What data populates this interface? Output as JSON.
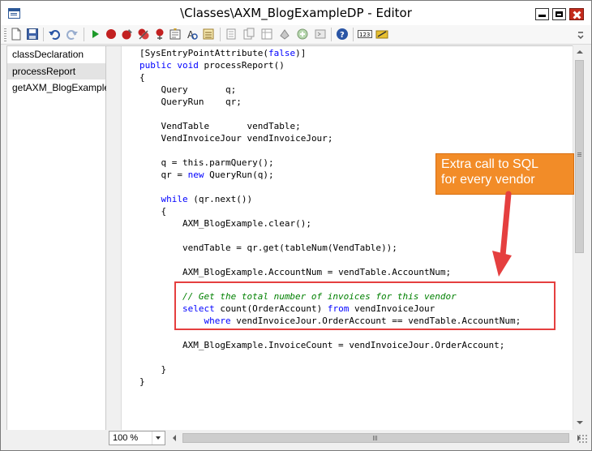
{
  "window": {
    "title": "\\Classes\\AXM_BlogExampleDP - Editor"
  },
  "toolbar": {
    "icons": [
      "new-icon",
      "save-icon",
      "undo-icon",
      "redo-icon",
      "run-icon",
      "breakpoint-icon",
      "toggle-breakpoint-icon",
      "remove-breakpoints-icon",
      "compile-icon",
      "lookup-icon",
      "properties-icon",
      "list-tables-icon",
      "list-classes-icon",
      "list-types-icon",
      "list-enums-icon",
      "list-reserved-icon",
      "script-icon",
      "help-icon",
      "line-numbers-icon",
      "source-control-icon"
    ]
  },
  "methods": [
    {
      "label": "classDeclaration",
      "selected": false
    },
    {
      "label": "processReport",
      "selected": true
    },
    {
      "label": "getAXM_BlogExample",
      "selected": false
    }
  ],
  "code": {
    "lines": [
      "[SysEntryPointAttribute(false)]",
      "public void processReport()",
      "{",
      "    Query       q;",
      "    QueryRun    qr;",
      "",
      "    VendTable       vendTable;",
      "    VendInvoiceJour vendInvoiceJour;",
      "",
      "    q = this.parmQuery();",
      "    qr = new QueryRun(q);",
      "",
      "    while (qr.next())",
      "    {",
      "        AXM_BlogExample.clear();",
      "",
      "        vendTable = qr.get(tableNum(VendTable));",
      "",
      "        AXM_BlogExample.AccountNum = vendTable.AccountNum;",
      "",
      "        // Get the total number of invoices for this vendor",
      "        select count(OrderAccount) from vendInvoiceJour",
      "            where vendInvoiceJour.OrderAccount == vendTable.AccountNum;",
      "",
      "        AXM_BlogExample.InvoiceCount = vendInvoiceJour.OrderAccount;",
      "",
      "    }",
      "}"
    ],
    "keywords": [
      "false",
      "public",
      "void",
      "new",
      "while",
      "select",
      "from",
      "where"
    ],
    "keyword_color": "#0000ff",
    "comment_color": "#008000"
  },
  "annotation": {
    "callout_line1": "Extra call to SQL",
    "callout_line2": "for every vendor",
    "callout_color": "#f28c28",
    "box_color": "#e53f3f"
  },
  "statusbar": {
    "zoom": "100 %"
  }
}
